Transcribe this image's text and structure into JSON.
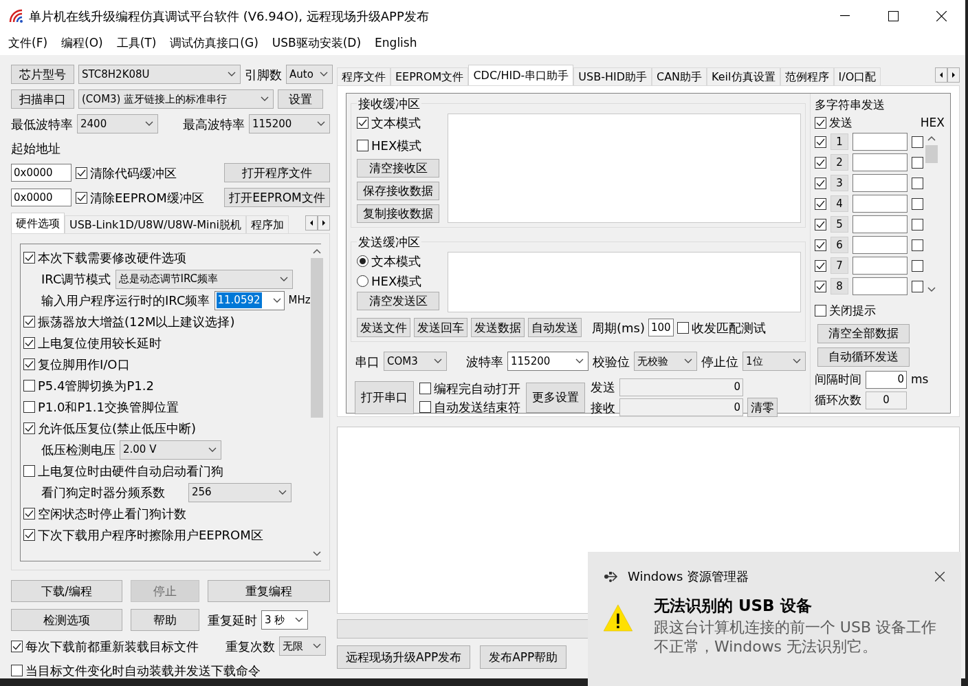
{
  "window": {
    "title": "单片机在线升级编程仿真调试平台软件 (V6.94O), 远程现场升级APP发布"
  },
  "menu": [
    "文件(F)",
    "编程(O)",
    "工具(T)",
    "调试仿真接口(G)",
    "USB驱动安装(D)",
    "English"
  ],
  "left": {
    "chip_button": "芯片型号",
    "chip_model": "STC8H2K08U",
    "pin_count_label": "引脚数",
    "pin_count": "Auto",
    "scan_button": "扫描串口",
    "port": "(COM3) 蓝牙链接上的标准串行",
    "settings_button": "设置",
    "min_baud_label": "最低波特率",
    "min_baud": "2400",
    "max_baud_label": "最高波特率",
    "max_baud": "115200",
    "start_address_label": "起始地址",
    "address_rows": [
      {
        "address": "0x0000",
        "label": "清除代码缓冲区",
        "checked": true,
        "button": "打开程序文件"
      },
      {
        "address": "0x0000",
        "label": "清除EEPROM缓冲区",
        "checked": true,
        "button": "打开EEPROM文件"
      }
    ],
    "tabs": [
      {
        "label": "硬件选项",
        "selected": true
      },
      {
        "label": "USB-Link1D/U8W/U8W-Mini脱机",
        "selected": false
      },
      {
        "label": "程序加",
        "selected": false
      }
    ],
    "options": [
      {
        "kind": "check",
        "label": "本次下载需要修改硬件选项",
        "checked": true
      },
      {
        "kind": "select",
        "label": "IRC调节模式",
        "value": "总是动态调节IRC频率"
      },
      {
        "kind": "freq",
        "label": "输入用户程序运行时的IRC频率",
        "value": "11.0592",
        "unit": "MHz"
      },
      {
        "kind": "check",
        "label": "振荡器放大增益(12M以上建议选择)",
        "checked": true
      },
      {
        "kind": "check",
        "label": "上电复位使用较长延时",
        "checked": true
      },
      {
        "kind": "check",
        "label": "复位脚用作I/O口",
        "checked": true
      },
      {
        "kind": "check",
        "label": "P5.4管脚切换为P1.2",
        "checked": false
      },
      {
        "kind": "check",
        "label": "P1.0和P1.1交换管脚位置",
        "checked": false
      },
      {
        "kind": "check",
        "label": "允许低压复位(禁止低压中断)",
        "checked": true
      },
      {
        "kind": "select",
        "label": "低压检测电压",
        "value": "2.00 V"
      },
      {
        "kind": "check",
        "label": "上电复位时由硬件自动启动看门狗",
        "checked": false
      },
      {
        "kind": "select",
        "label": "看门狗定时器分频系数",
        "value": "256"
      },
      {
        "kind": "check",
        "label": "空闲状态时停止看门狗计数",
        "checked": true
      },
      {
        "kind": "check",
        "label": "下次下载用户程序时擦除用户EEPROM区",
        "checked": true
      }
    ],
    "buttons": [
      {
        "label": "下载/编程",
        "disabled": false
      },
      {
        "label": "停止",
        "disabled": true
      },
      {
        "label": "重复编程",
        "disabled": false
      },
      {
        "label": "检测选项",
        "disabled": false
      },
      {
        "label": "帮助",
        "disabled": false
      }
    ],
    "repeat_delay_label": "重复延时",
    "repeat_delay": "3 秒",
    "repeat_count_label": "重复次数",
    "repeat_count": "无限",
    "bottom_checks": [
      {
        "label": "每次下载前都重新装载目标文件",
        "checked": true
      },
      {
        "label": "当目标文件变化时自动装载并发送下载命令",
        "checked": false
      }
    ]
  },
  "right": {
    "tabs": [
      {
        "label": "程序文件",
        "selected": false
      },
      {
        "label": "EEPROM文件",
        "selected": false
      },
      {
        "label": "CDC/HID-串口助手",
        "selected": true
      },
      {
        "label": "USB-HID助手",
        "selected": false
      },
      {
        "label": "CAN助手",
        "selected": false
      },
      {
        "label": "Keil仿真设置",
        "selected": false
      },
      {
        "label": "范例程序",
        "selected": false
      },
      {
        "label": "I/O口配",
        "selected": false
      }
    ],
    "receive": {
      "title": "接收缓冲区",
      "modes": [
        {
          "label": "文本模式",
          "checked": true
        },
        {
          "label": "HEX模式",
          "checked": false
        }
      ],
      "buttons": [
        "清空接收区",
        "保存接收数据",
        "复制接收数据"
      ]
    },
    "send": {
      "title": "发送缓冲区",
      "modes": [
        {
          "label": "文本模式",
          "selected": true
        },
        {
          "label": "HEX模式",
          "selected": false
        }
      ],
      "clear_button": "清空发送区",
      "buttons": [
        "发送文件",
        "发送回车",
        "发送数据",
        "自动发送"
      ],
      "period_label": "周期(ms)",
      "period": "100",
      "match_test": {
        "label": "收发匹配测试",
        "checked": false
      }
    },
    "serial": {
      "port_label": "串口",
      "port": "COM3",
      "baud_label": "波特率",
      "baud": "115200",
      "parity_label": "校验位",
      "parity": "无校验",
      "stop_label": "停止位",
      "stop": "1位",
      "open_button": "打开串口",
      "options": [
        {
          "label": "编程完自动打开",
          "checked": false
        },
        {
          "label": "自动发送结束符",
          "checked": false
        }
      ],
      "more_button": "更多设置",
      "send_label": "发送",
      "send_count": "0",
      "receive_label": "接收",
      "receive_count": "0",
      "clear_button": "清零"
    },
    "multi": {
      "title": "多字符串发送",
      "send": {
        "label": "发送",
        "checked": true
      },
      "hex_label": "HEX",
      "rows": [
        {
          "number": "1",
          "checked": true,
          "hex": false
        },
        {
          "number": "2",
          "checked": true,
          "hex": false
        },
        {
          "number": "3",
          "checked": true,
          "hex": false
        },
        {
          "number": "4",
          "checked": true,
          "hex": false
        },
        {
          "number": "5",
          "checked": true,
          "hex": false
        },
        {
          "number": "6",
          "checked": true,
          "hex": false
        },
        {
          "number": "7",
          "checked": true,
          "hex": false
        },
        {
          "number": "8",
          "checked": true,
          "hex": false
        }
      ],
      "close_tip": {
        "label": "关闭提示",
        "checked": false
      },
      "buttons": [
        "清空全部数据",
        "自动循环发送"
      ],
      "interval_label": "间隔时间",
      "interval": "0",
      "interval_unit": "ms",
      "loops_label": "循环次数",
      "loops": "0"
    },
    "progress": {
      "level": 0
    },
    "bottom_buttons": [
      "远程现场升级APP发布",
      "发布APP帮助"
    ]
  },
  "notification": {
    "app": "Windows 资源管理器",
    "title": "无法识别的 USB 设备",
    "message": "跟这台计算机连接的前一个 USB 设备工作不正常，Windows 无法识别它。"
  }
}
